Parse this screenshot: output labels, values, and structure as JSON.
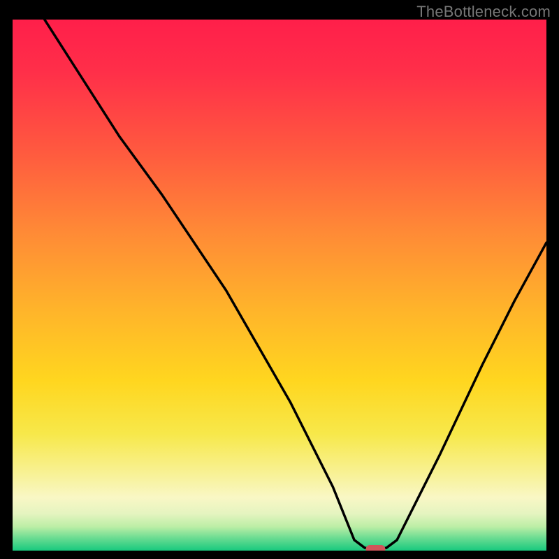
{
  "watermark": "TheBottleneck.com",
  "chart_data": {
    "type": "line",
    "title": "",
    "xlabel": "",
    "ylabel": "",
    "xlim": [
      0,
      100
    ],
    "ylim": [
      0,
      100
    ],
    "grid": false,
    "legend": false,
    "marker": {
      "x": 68,
      "y": 0,
      "color": "#d0555a",
      "shape": "pill"
    },
    "curve_points": [
      {
        "x": 6,
        "y": 100
      },
      {
        "x": 20,
        "y": 78
      },
      {
        "x": 28,
        "y": 67
      },
      {
        "x": 40,
        "y": 49
      },
      {
        "x": 52,
        "y": 28
      },
      {
        "x": 60,
        "y": 12
      },
      {
        "x": 64,
        "y": 2
      },
      {
        "x": 66,
        "y": 0.5
      },
      {
        "x": 70,
        "y": 0.5
      },
      {
        "x": 72,
        "y": 2
      },
      {
        "x": 80,
        "y": 18
      },
      {
        "x": 88,
        "y": 35
      },
      {
        "x": 94,
        "y": 47
      },
      {
        "x": 100,
        "y": 58
      }
    ],
    "gradient_stops": [
      {
        "offset": 0.0,
        "color": "#ff1f4a"
      },
      {
        "offset": 0.1,
        "color": "#ff2f49"
      },
      {
        "offset": 0.25,
        "color": "#ff5a3f"
      },
      {
        "offset": 0.4,
        "color": "#ff8a36"
      },
      {
        "offset": 0.55,
        "color": "#ffb52a"
      },
      {
        "offset": 0.68,
        "color": "#ffd61f"
      },
      {
        "offset": 0.78,
        "color": "#f7e84a"
      },
      {
        "offset": 0.86,
        "color": "#f8f29a"
      },
      {
        "offset": 0.9,
        "color": "#f9f7c5"
      },
      {
        "offset": 0.93,
        "color": "#e5f4c0"
      },
      {
        "offset": 0.955,
        "color": "#bceea6"
      },
      {
        "offset": 0.975,
        "color": "#6fdd93"
      },
      {
        "offset": 1.0,
        "color": "#18c97e"
      }
    ]
  }
}
